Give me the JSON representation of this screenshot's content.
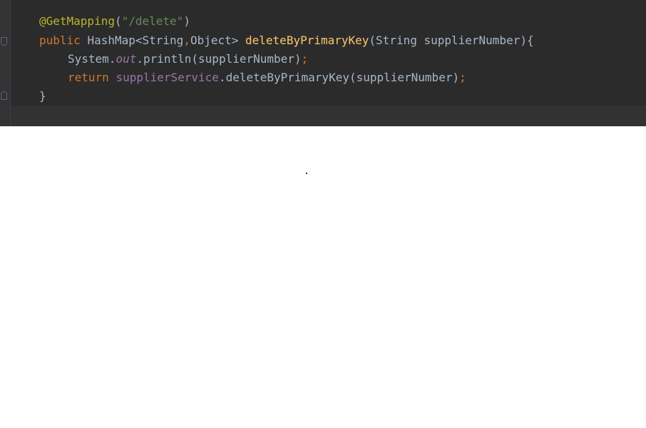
{
  "editor": {
    "lines": [
      {
        "annotation": "@GetMapping",
        "open_paren": "(",
        "string_literal": "\"/delete\"",
        "close_paren": ")"
      },
      {
        "keyword_public": "public",
        "type_hashmap": "HashMap<String",
        "comma": ",",
        "type_object": "Object>",
        "method_name": "deleteByPrimaryKey",
        "params": "(String supplierNumber){"
      },
      {
        "system": "System.",
        "out_field": "out",
        "println_call": ".println(supplierNumber)",
        "semicolon": ";"
      },
      {
        "keyword_return": "return",
        "service_field": "supplierService",
        "call": ".deleteByPrimaryKey(supplierNumber)",
        "semicolon": ";"
      },
      {
        "closing_brace": "}"
      }
    ],
    "colors": {
      "background": "#2b2b2b",
      "default_text": "#a9b7c6",
      "keyword": "#cc7832",
      "annotation": "#bbb529",
      "string": "#6a8759",
      "method_declaration": "#ffc66d",
      "field": "#9876aa"
    }
  }
}
